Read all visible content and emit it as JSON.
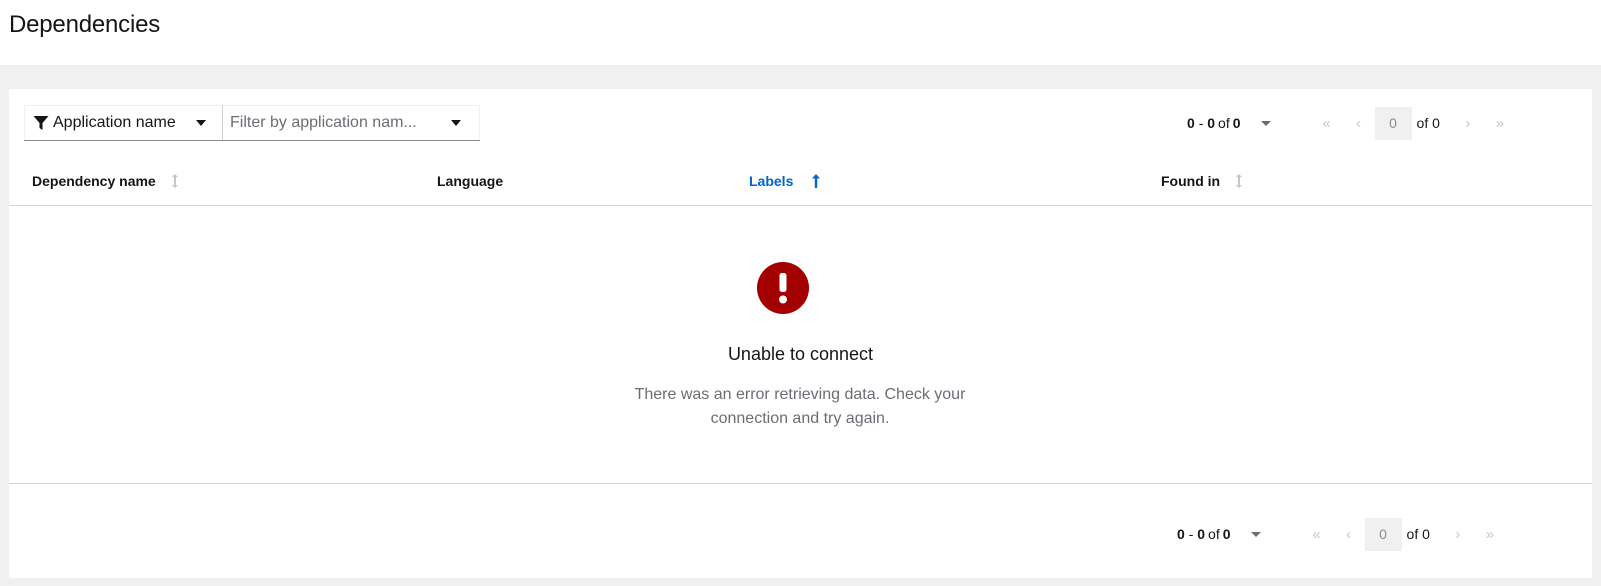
{
  "page": {
    "title": "Dependencies"
  },
  "toolbar": {
    "filter_attribute_label": "Application name",
    "filter_placeholder": "Filter by application nam..."
  },
  "pagination": {
    "range_start": "0",
    "range_end": "0",
    "range_separator": "-",
    "of_word": "of",
    "total": "0",
    "current_page": "0",
    "of_pages_label": "of 0"
  },
  "table": {
    "columns": [
      {
        "label": "Dependency name",
        "sortable": true,
        "active": false
      },
      {
        "label": "Language",
        "sortable": false,
        "active": false
      },
      {
        "label": "Labels",
        "sortable": true,
        "active": true,
        "sort_direction": "ascending"
      },
      {
        "label": "Found in",
        "sortable": true,
        "active": false
      }
    ]
  },
  "empty_state": {
    "icon": "exclamation-circle-icon",
    "title": "Unable to connect",
    "body": "There was an error retrieving data. Check your connection and try again."
  },
  "colors": {
    "error": "#a30000",
    "link": "#0066cc",
    "disabled": "#c7c7c7"
  }
}
